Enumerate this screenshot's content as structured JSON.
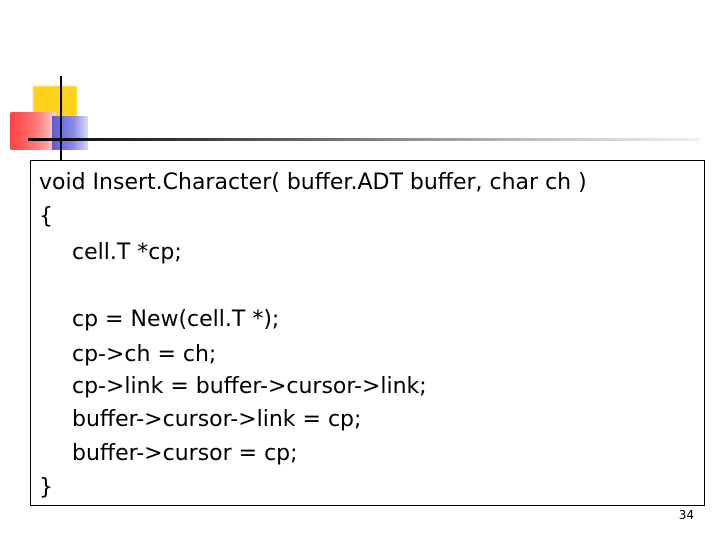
{
  "slide": {
    "code_lines": [
      "void Insert.Character( buffer.ADT buffer, char ch )",
      "{",
      "cell.T *cp;",
      "cp = New(cell.T *);",
      "cp->ch = ch;",
      "cp->link = buffer->cursor->link;",
      "buffer->cursor->link = cp;",
      "buffer->cursor = cp;",
      "}"
    ],
    "page_number": "34"
  },
  "colors": {
    "accent_yellow": "#ffd21a",
    "accent_red": "#ff4040",
    "accent_blue": "#5b5bd6"
  }
}
